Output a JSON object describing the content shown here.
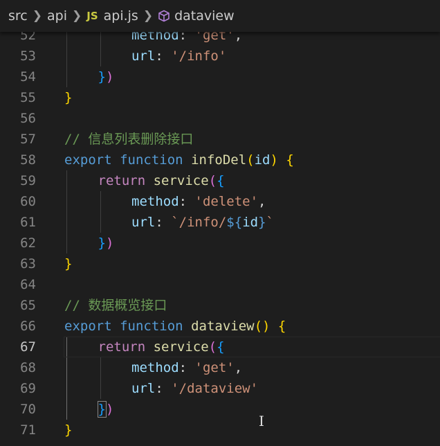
{
  "breadcrumb": {
    "items": [
      "src",
      "api",
      "api.js",
      "dataview"
    ],
    "js_badge": "JS"
  },
  "editor": {
    "current_line": "67",
    "lines": [
      {
        "n": "52",
        "parts": [
          [
            "prop",
            "method"
          ],
          [
            "pun",
            ": "
          ],
          [
            "str",
            "'get'"
          ],
          [
            "pun",
            ","
          ]
        ]
      },
      {
        "n": "53",
        "parts": [
          [
            "prop",
            "url"
          ],
          [
            "pun",
            ": "
          ],
          [
            "str",
            "'/info'"
          ]
        ]
      },
      {
        "n": "54",
        "parts": [
          [
            "b3",
            "}"
          ],
          [
            "b2",
            ")"
          ]
        ]
      },
      {
        "n": "55",
        "parts": [
          [
            "b1",
            "}"
          ]
        ]
      },
      {
        "n": "56",
        "parts": []
      },
      {
        "n": "57",
        "parts": [
          [
            "cmt",
            "// 信息列表删除接口"
          ]
        ]
      },
      {
        "n": "58",
        "parts": [
          [
            "kw",
            "export"
          ],
          [
            "pun",
            " "
          ],
          [
            "kw",
            "function"
          ],
          [
            "pun",
            " "
          ],
          [
            "fn",
            "infoDel"
          ],
          [
            "b1",
            "("
          ],
          [
            "param",
            "id"
          ],
          [
            "b1",
            ")"
          ],
          [
            "pun",
            " "
          ],
          [
            "b1",
            "{"
          ]
        ]
      },
      {
        "n": "59",
        "parts": [
          [
            "ctrl",
            "return"
          ],
          [
            "pun",
            " "
          ],
          [
            "fn",
            "service"
          ],
          [
            "b2",
            "("
          ],
          [
            "b3",
            "{"
          ]
        ]
      },
      {
        "n": "60",
        "parts": [
          [
            "prop",
            "method"
          ],
          [
            "pun",
            ": "
          ],
          [
            "str",
            "'delete'"
          ],
          [
            "pun",
            ","
          ]
        ]
      },
      {
        "n": "61",
        "parts": [
          [
            "prop",
            "url"
          ],
          [
            "pun",
            ": "
          ],
          [
            "str",
            "`/info/"
          ],
          [
            "tplb",
            "${"
          ],
          [
            "param",
            "id"
          ],
          [
            "tplb",
            "}"
          ],
          [
            "str",
            "`"
          ]
        ]
      },
      {
        "n": "62",
        "parts": [
          [
            "b3",
            "}"
          ],
          [
            "b2",
            ")"
          ]
        ]
      },
      {
        "n": "63",
        "parts": [
          [
            "b1",
            "}"
          ]
        ]
      },
      {
        "n": "64",
        "parts": []
      },
      {
        "n": "65",
        "parts": [
          [
            "cmt",
            "// 数据概览接口"
          ]
        ]
      },
      {
        "n": "66",
        "parts": [
          [
            "kw",
            "export"
          ],
          [
            "pun",
            " "
          ],
          [
            "kw",
            "function"
          ],
          [
            "pun",
            " "
          ],
          [
            "fn",
            "dataview"
          ],
          [
            "b1",
            "()"
          ],
          [
            "pun",
            " "
          ],
          [
            "b1",
            "{"
          ]
        ]
      },
      {
        "n": "67",
        "parts": [
          [
            "ctrl",
            "return"
          ],
          [
            "pun",
            " "
          ],
          [
            "fn",
            "service"
          ],
          [
            "b2",
            "("
          ],
          [
            "b3",
            "{"
          ]
        ]
      },
      {
        "n": "68",
        "parts": [
          [
            "prop",
            "method"
          ],
          [
            "pun",
            ": "
          ],
          [
            "str",
            "'get'"
          ],
          [
            "pun",
            ","
          ]
        ]
      },
      {
        "n": "69",
        "parts": [
          [
            "prop",
            "url"
          ],
          [
            "pun",
            ": "
          ],
          [
            "str",
            "'/dataview'"
          ]
        ]
      },
      {
        "n": "70",
        "parts": [
          [
            "b3",
            "}"
          ],
          [
            "b2",
            ")"
          ]
        ]
      },
      {
        "n": "71",
        "parts": [
          [
            "b1",
            "}"
          ]
        ]
      }
    ]
  },
  "cursor_glyph": "I"
}
